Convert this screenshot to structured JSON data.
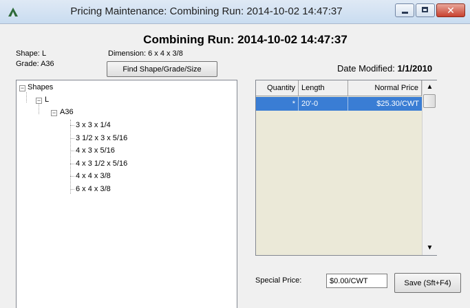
{
  "window": {
    "title": "Pricing Maintenance: Combining Run: 2014-10-02 14:47:37",
    "controls": {
      "minimize": "minimize-icon",
      "maximize": "maximize-icon",
      "close": "close-icon"
    }
  },
  "heading": "Combining Run: 2014-10-02 14:47:37",
  "selection": {
    "shape_label": "Shape:",
    "shape_value": "L",
    "grade_label": "Grade:",
    "grade_value": "A36",
    "dimension_label": "Dimension:",
    "dimension_value": "6 x 4 x 3/8",
    "find_button": "Find Shape/Grade/Size"
  },
  "date_modified": {
    "label": "Date Modified:",
    "value": "1/1/2010"
  },
  "tree": {
    "root": "Shapes",
    "shape": "L",
    "grade": "A36",
    "sizes": [
      "3 x 3 x 1/4",
      "3 1/2 x 3 x 5/16",
      "4 x 3 x 5/16",
      "4 x 3 1/2 x 5/16",
      "4 x 4 x 3/8",
      "6 x 4 x 3/8"
    ]
  },
  "price_grid": {
    "columns": [
      "Quantity",
      "Length",
      "Normal Price"
    ],
    "rows": [
      {
        "quantity": "*",
        "length": "20'-0",
        "normal_price": "$25.30/CWT"
      }
    ]
  },
  "special_price": {
    "label": "Special Price:",
    "value": "$0.00/CWT"
  },
  "save_button": "Save (Sft+F4)",
  "colors": {
    "selection": "#3a7dd4",
    "grid_background": "#ebe9d8",
    "close_button": "#c7412f"
  }
}
